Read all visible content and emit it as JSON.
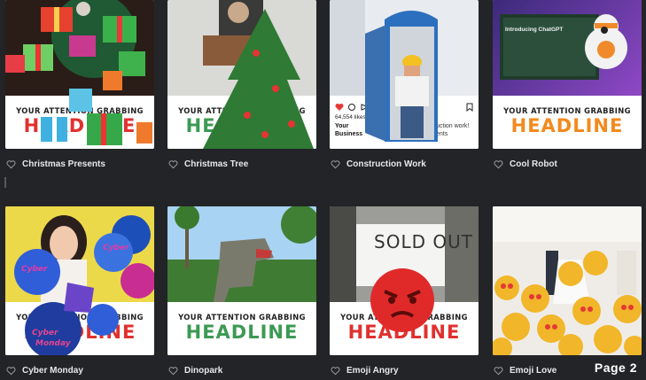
{
  "page": {
    "label": "Page 2"
  },
  "colors": {
    "background": "#232427",
    "caption_text": "#e8e8ea",
    "headline_red": "#e0312f",
    "headline_green": "#3c9a54",
    "headline_orange": "#f28a1e",
    "small_text": "#222222"
  },
  "cards": [
    {
      "title": "Christmas Presents",
      "small": "Your attention grabbing",
      "big": "Headline",
      "big_color": "#e0312f",
      "icon": "heart-outline-icon"
    },
    {
      "title": "Christmas Tree",
      "small": "Your attention grabbing",
      "big": "Headline",
      "big_color": "#3c9a54",
      "icon": "heart-outline-icon"
    },
    {
      "title": "Construction Work",
      "icon": "heart-outline-icon",
      "instagram": {
        "likes": "64,554 likes",
        "username": "Your",
        "business": "Business",
        "note": "uction work!",
        "sub": "ents"
      }
    },
    {
      "title": "Cool Robot",
      "small": "Your attention grabbing",
      "big": "Headline",
      "big_color": "#f28a1e",
      "icon": "heart-outline-icon",
      "screen_title": "Introducing ChatGPT"
    },
    {
      "title": "Cyber Monday",
      "small": "Your attention grabbing",
      "big": "Headline",
      "big_color": "#e0312f",
      "icon": "heart-outline-icon",
      "balloon_text": [
        "Cyber",
        "Monday"
      ]
    },
    {
      "title": "Dinopark",
      "small": "Your attention grabbing",
      "big": "Headline",
      "big_color": "#3c9a54",
      "icon": "heart-outline-icon"
    },
    {
      "title": "Emoji Angry",
      "small": "Your attention grabbing",
      "big": "Headline",
      "big_color": "#e0312f",
      "icon": "heart-outline-icon",
      "sign_text": "SOLD OUT"
    },
    {
      "title": "Emoji Love",
      "small": "",
      "big": "",
      "icon": "heart-outline-icon"
    }
  ]
}
